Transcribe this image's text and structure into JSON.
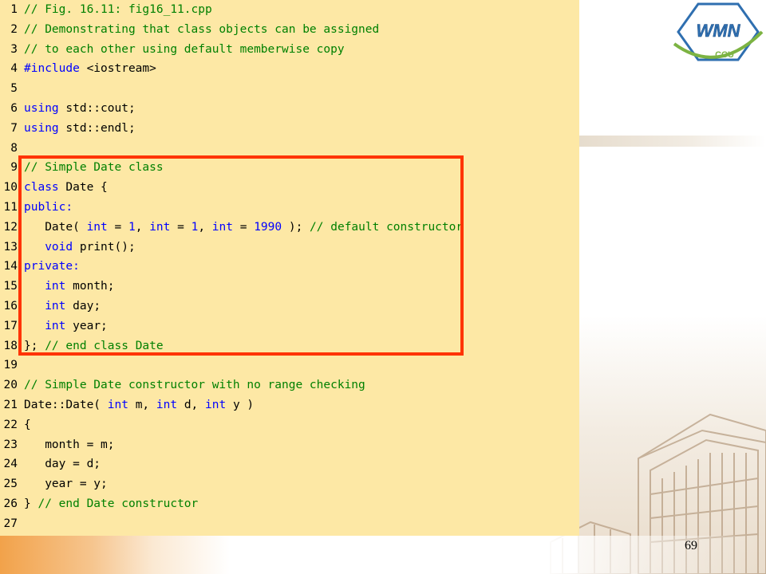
{
  "slide": {
    "page_number": "69",
    "logo_text_main": "WMN",
    "logo_text_sub": "CCU"
  },
  "code": {
    "lines": [
      {
        "n": "1",
        "segments": [
          {
            "t": "// Fig. 16.11: fig16_11.cpp",
            "c": "cm"
          }
        ]
      },
      {
        "n": "2",
        "segments": [
          {
            "t": "// Demonstrating that class objects can be assigned",
            "c": "cm"
          }
        ]
      },
      {
        "n": "3",
        "segments": [
          {
            "t": "// to each other using default memberwise copy",
            "c": "cm"
          }
        ]
      },
      {
        "n": "4",
        "segments": [
          {
            "t": "#include",
            "c": "kw"
          },
          {
            "t": " <iostream>",
            "c": ""
          }
        ]
      },
      {
        "n": "5",
        "segments": []
      },
      {
        "n": "6",
        "segments": [
          {
            "t": "using",
            "c": "kw"
          },
          {
            "t": " std::cout;",
            "c": ""
          }
        ]
      },
      {
        "n": "7",
        "segments": [
          {
            "t": "using",
            "c": "kw"
          },
          {
            "t": " std::endl;",
            "c": ""
          }
        ]
      },
      {
        "n": "8",
        "segments": []
      },
      {
        "n": "9",
        "segments": [
          {
            "t": "// Simple Date class",
            "c": "cm"
          }
        ]
      },
      {
        "n": "10",
        "segments": [
          {
            "t": "class",
            "c": "kw"
          },
          {
            "t": " Date {",
            "c": ""
          }
        ]
      },
      {
        "n": "11",
        "segments": [
          {
            "t": "public:",
            "c": "kw"
          }
        ]
      },
      {
        "n": "12",
        "segments": [
          {
            "t": "   Date( ",
            "c": ""
          },
          {
            "t": "int",
            "c": "kw"
          },
          {
            "t": " = ",
            "c": ""
          },
          {
            "t": "1",
            "c": "num"
          },
          {
            "t": ", ",
            "c": ""
          },
          {
            "t": "int",
            "c": "kw"
          },
          {
            "t": " = ",
            "c": ""
          },
          {
            "t": "1",
            "c": "num"
          },
          {
            "t": ", ",
            "c": ""
          },
          {
            "t": "int",
            "c": "kw"
          },
          {
            "t": " = ",
            "c": ""
          },
          {
            "t": "1990",
            "c": "num"
          },
          {
            "t": " ); ",
            "c": ""
          },
          {
            "t": "// default constructor",
            "c": "cm"
          }
        ]
      },
      {
        "n": "13",
        "segments": [
          {
            "t": "   ",
            "c": ""
          },
          {
            "t": "void",
            "c": "kw"
          },
          {
            "t": " print();",
            "c": ""
          }
        ]
      },
      {
        "n": "14",
        "segments": [
          {
            "t": "private:",
            "c": "kw"
          }
        ]
      },
      {
        "n": "15",
        "segments": [
          {
            "t": "   ",
            "c": ""
          },
          {
            "t": "int",
            "c": "kw"
          },
          {
            "t": " month;",
            "c": ""
          }
        ]
      },
      {
        "n": "16",
        "segments": [
          {
            "t": "   ",
            "c": ""
          },
          {
            "t": "int",
            "c": "kw"
          },
          {
            "t": " day;",
            "c": ""
          }
        ]
      },
      {
        "n": "17",
        "segments": [
          {
            "t": "   ",
            "c": ""
          },
          {
            "t": "int",
            "c": "kw"
          },
          {
            "t": " year;",
            "c": ""
          }
        ]
      },
      {
        "n": "18",
        "segments": [
          {
            "t": "}; ",
            "c": ""
          },
          {
            "t": "// end class Date",
            "c": "cm"
          }
        ]
      },
      {
        "n": "19",
        "segments": []
      },
      {
        "n": "20",
        "segments": [
          {
            "t": "// Simple Date constructor with no range checking",
            "c": "cm"
          }
        ]
      },
      {
        "n": "21",
        "segments": [
          {
            "t": "Date::Date( ",
            "c": ""
          },
          {
            "t": "int",
            "c": "kw"
          },
          {
            "t": " m, ",
            "c": ""
          },
          {
            "t": "int",
            "c": "kw"
          },
          {
            "t": " d, ",
            "c": ""
          },
          {
            "t": "int",
            "c": "kw"
          },
          {
            "t": " y )",
            "c": ""
          }
        ]
      },
      {
        "n": "22",
        "segments": [
          {
            "t": "{",
            "c": ""
          }
        ]
      },
      {
        "n": "23",
        "segments": [
          {
            "t": "   month = m;",
            "c": ""
          }
        ]
      },
      {
        "n": "24",
        "segments": [
          {
            "t": "   day = d;",
            "c": ""
          }
        ]
      },
      {
        "n": "25",
        "segments": [
          {
            "t": "   year = y;",
            "c": ""
          }
        ]
      },
      {
        "n": "26",
        "segments": [
          {
            "t": "} ",
            "c": ""
          },
          {
            "t": "// end Date constructor",
            "c": "cm"
          }
        ]
      },
      {
        "n": "27",
        "segments": []
      }
    ]
  },
  "colors": {
    "code_background": "#fde8a5",
    "keyword": "#0000ff",
    "comment": "#008000",
    "highlight_border": "#ff3300"
  }
}
